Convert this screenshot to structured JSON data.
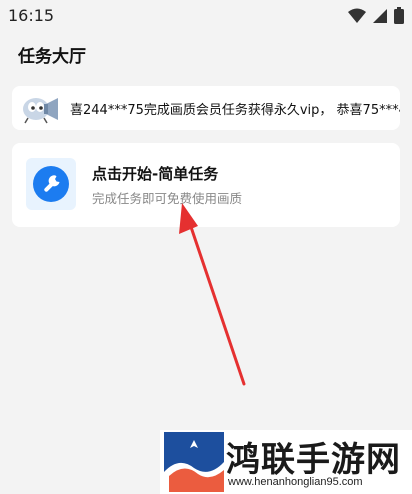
{
  "status_bar": {
    "time": "16:15"
  },
  "page": {
    "title": "任务大厅"
  },
  "marquee": {
    "text": "喜244***75完成画质会员任务获得永久vip， 恭喜75***41完成"
  },
  "task": {
    "title": "点击开始-简单任务",
    "subtitle": "完成任务即可免费使用画质"
  },
  "watermark": {
    "name": "鸿联手游网",
    "url": "www.henanhonglian95.com"
  },
  "colors": {
    "accent": "#1c7cf0",
    "arrow": "#e53030",
    "background": "#f3f3f3"
  }
}
